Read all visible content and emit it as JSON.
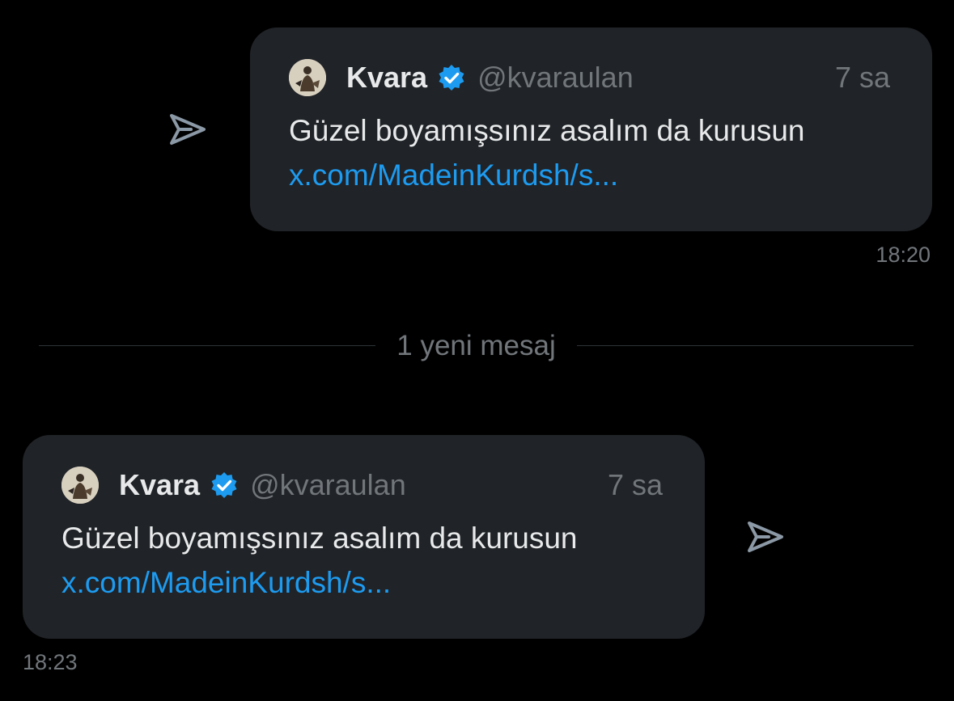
{
  "colors": {
    "background": "#000000",
    "bubble": "#202327",
    "primary_text": "#e7e9ea",
    "secondary_text": "#71767b",
    "link": "#1d9bf0",
    "verified_badge": "#1d9bf0",
    "share_icon": "#8b98a5"
  },
  "messages": [
    {
      "direction": "sent",
      "share_icon": "share-arrow-icon",
      "quote": {
        "author_name": "Kvara",
        "verified_icon": "verified-badge-icon",
        "handle": "@kvaraulan",
        "time_ago": "7 sa",
        "text": "Güzel boyamışsınız asalım da kurusun",
        "link": "x.com/MadeinKurdsh/s..."
      },
      "timestamp": "18:20"
    },
    {
      "direction": "received",
      "share_icon": "share-arrow-icon",
      "quote": {
        "author_name": "Kvara",
        "verified_icon": "verified-badge-icon",
        "handle": "@kvaraulan",
        "time_ago": "7 sa",
        "text": "Güzel boyamışsınız asalım da kurusun",
        "link": "x.com/MadeinKurdsh/s..."
      },
      "timestamp": "18:23"
    }
  ],
  "divider": {
    "label": "1 yeni mesaj"
  }
}
